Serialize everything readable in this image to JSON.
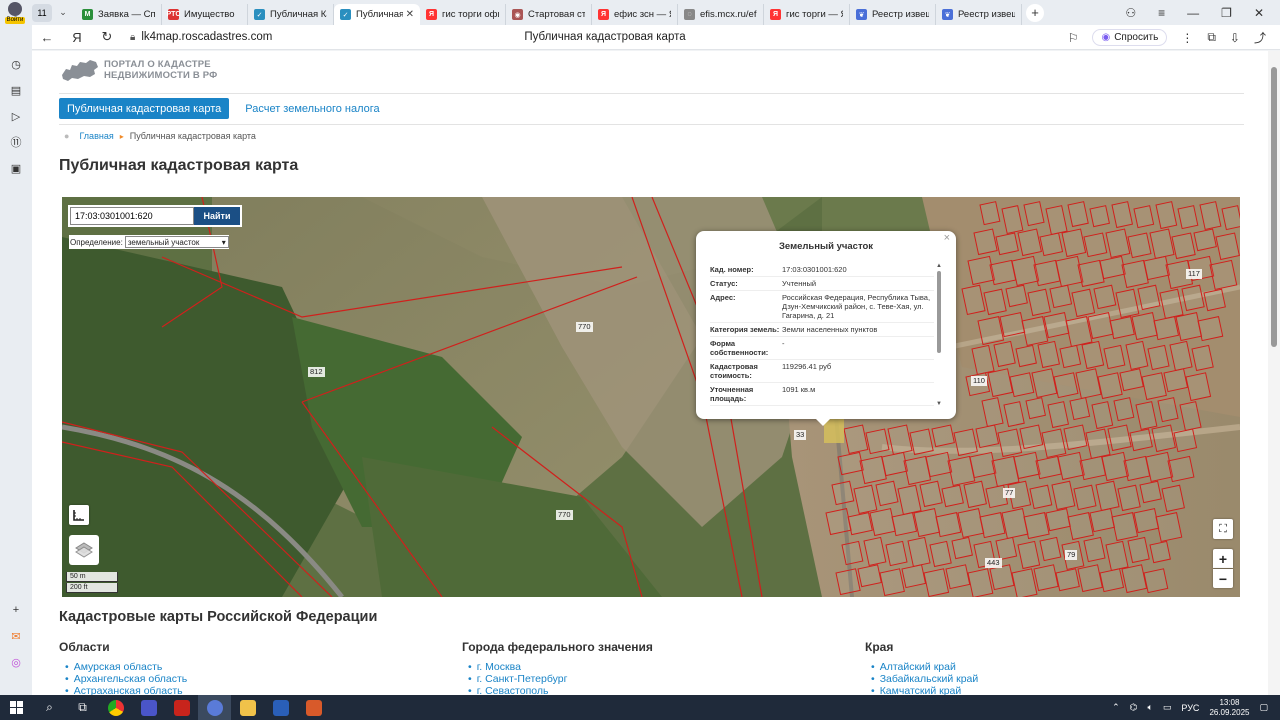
{
  "browser": {
    "profile_label": "Войти",
    "tab_count": "11",
    "tabs": [
      {
        "title": "Заявка — Спи",
        "color": "#2a8f3a",
        "glyph": "M"
      },
      {
        "title": "Имущество",
        "color": "#d33",
        "glyph": "РТС"
      },
      {
        "title": "Публичная Ка",
        "color": "#2a8fbf",
        "glyph": "✓"
      },
      {
        "title": "Публичная",
        "color": "#2a8fbf",
        "glyph": "✓",
        "active": true
      },
      {
        "title": "гис торги офи",
        "color": "#f33",
        "glyph": "Я"
      },
      {
        "title": "Стартовая стр",
        "color": "#a55",
        "glyph": "◉"
      },
      {
        "title": "ефис зсн — Ян",
        "color": "#f33",
        "glyph": "Я"
      },
      {
        "title": "efis.mcx.ru/efi",
        "color": "#888",
        "glyph": "◌"
      },
      {
        "title": "гис торги — Ян",
        "color": "#f33",
        "glyph": "Я"
      },
      {
        "title": "Реестр извеще",
        "color": "#4a6fd8",
        "glyph": "❦"
      },
      {
        "title": "Реестр извещ",
        "color": "#4a6fd8",
        "glyph": "❦"
      }
    ],
    "url": "lk4map.roscadastres.com",
    "page_title": "Публичная кадастровая карта",
    "ask_label": "Спросить"
  },
  "page": {
    "logo_line1": "ПОРТАЛ О КАДАСТРЕ",
    "logo_line2": "НЕДВИЖИМОСТИ В РФ",
    "nav_active": "Публичная кадастровая карта",
    "nav_link": "Расчет земельного налога",
    "breadcrumb_home": "Главная",
    "breadcrumb_current": "Публичная кадастровая карта",
    "title": "Публичная кадастровая карта",
    "map": {
      "search_value": "17:03:0301001:620",
      "search_button": "Найти",
      "definition_label": "Определение:",
      "definition_value": "земельный участок",
      "scale_m": "50 m",
      "scale_ft": "200 ft",
      "zoom_in": "+",
      "zoom_out": "−",
      "parcel_labels": [
        "770",
        "812",
        "770",
        "33",
        "117",
        "110",
        "77",
        "79",
        "443"
      ],
      "popup": {
        "title": "Земельный участок",
        "rows": [
          {
            "key": "Кад. номер:",
            "value": "17:03:0301001:620"
          },
          {
            "key": "Статус:",
            "value": "Учтенный"
          },
          {
            "key": "Адрес:",
            "value": "Российская Федерация, Республика Тыва, Дзун-Хемчикский район, с. Теве-Хая, ул. Гагарина, д. 21"
          },
          {
            "key": "Категория земель:",
            "value": "Земли населенных пунктов"
          },
          {
            "key": "Форма собственности:",
            "value": "-"
          },
          {
            "key": "Кадастровая стоимость:",
            "value": "119296.41 руб"
          },
          {
            "key": "Уточненная площадь:",
            "value": "1091 кв.м"
          }
        ]
      }
    },
    "subtitle": "Кадастровые карты Российской Федерации",
    "columns": [
      {
        "heading": "Области",
        "items": [
          "Амурская область",
          "Архангельская область",
          "Астраханская область"
        ]
      },
      {
        "heading": "Города федерального значения",
        "items": [
          "г. Москва",
          "г. Санкт-Петербург",
          "г. Севастополь"
        ]
      },
      {
        "heading": "Края",
        "items": [
          "Алтайский край",
          "Забайкальский край",
          "Камчатский край"
        ]
      }
    ]
  },
  "taskbar": {
    "lang": "РУС",
    "time": "13:08",
    "date": "26.09.2025"
  }
}
